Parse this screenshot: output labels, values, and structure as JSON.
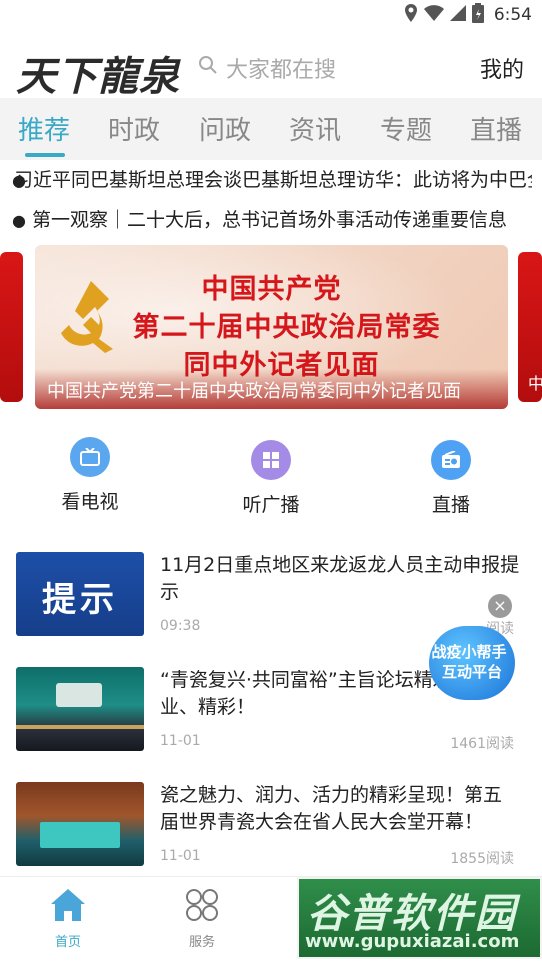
{
  "status_bar": {
    "time": "6:54",
    "icons": [
      "location-icon",
      "wifi-icon",
      "signal-icon",
      "battery-icon"
    ]
  },
  "header": {
    "logo_text": "天下龍泉",
    "search_placeholder": "大家都在搜",
    "mine_label": "我的"
  },
  "tabs": [
    "推荐",
    "时政",
    "问政",
    "资讯",
    "专题",
    "直播"
  ],
  "active_tab": "推荐",
  "headlines": [
    "习近平同巴基斯坦总理会谈巴基斯坦总理访华：此访将为中巴全天候战略合作伙伴关",
    "第一观察｜二十大后，总书记首场外事活动传递重要信息"
  ],
  "banner": {
    "title_lines": [
      "中国共产党",
      "第二十届中央政治局常委",
      "同中外记者见面"
    ],
    "caption": "中国共产党第二十届中央政治局常委同中外记者见面",
    "side_caption": "中"
  },
  "quick_entries": [
    {
      "label": "看电视",
      "icon": "tv-icon",
      "color": "#5aa6ef"
    },
    {
      "label": "听广播",
      "icon": "grid-icon",
      "color": "#a48be6"
    },
    {
      "label": "直播",
      "icon": "radio-icon",
      "color": "#4fa2f3"
    }
  ],
  "news": [
    {
      "title": "11月2日重点地区来龙返龙人员主动申报提示",
      "date": "09:38",
      "reads": "阅读",
      "thumb_text": "提示"
    },
    {
      "title": "“青瓷复兴·共同富裕”主旨论坛精彩、专业、精彩！",
      "date": "11-01",
      "reads": "1461阅读"
    },
    {
      "title": "瓷之魅力、润力、活力的精彩呈现！第五届世界青瓷大会在省人民大会堂开幕！",
      "date": "11-01",
      "reads": "1855阅读"
    }
  ],
  "float_helper": {
    "line1": "战疫小帮手",
    "line2": "互动平台",
    "close": "×"
  },
  "bottom_nav": [
    {
      "label": "首页",
      "icon": "home-icon",
      "active": true
    },
    {
      "label": "服务",
      "icon": "services-icon",
      "active": false
    }
  ],
  "watermark": {
    "top": "谷普软件园",
    "bottom": "www.gupuxiazai.com"
  },
  "colors": {
    "accent": "#3aa9c7",
    "tab_bg": "#f3f3f3",
    "party_red": "#d5161a"
  }
}
